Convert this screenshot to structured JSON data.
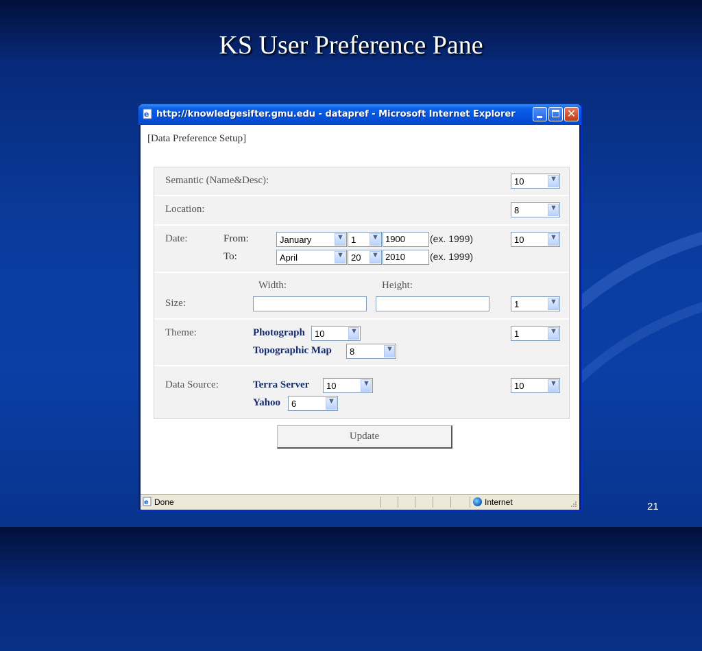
{
  "slide": {
    "title": "KS User Preference Pane",
    "page_number": "21"
  },
  "window": {
    "title": "http://knowledgesifter.gmu.edu - datapref - Microsoft Internet Explorer",
    "icons": {
      "page": "ie-page-icon",
      "minimize": "minimize-icon",
      "maximize": "maximize-icon",
      "close": "close-icon"
    },
    "close_glyph": "✕"
  },
  "form": {
    "heading": "[Data Preference Setup]",
    "semantic": {
      "label": "Semantic (Name&Desc):",
      "weight": "10"
    },
    "location": {
      "label": "Location:",
      "weight": "8"
    },
    "date": {
      "label": "Date:",
      "from_label": "From:",
      "from_month": "January",
      "from_day": "1",
      "from_year": "1900",
      "to_label": "To:",
      "to_month": "April",
      "to_day": "20",
      "to_year": "2010",
      "hint": "(ex. 1999)",
      "weight": "10"
    },
    "size": {
      "label": "Size:",
      "width_label": "Width:",
      "width_value": "",
      "height_label": "Height:",
      "height_value": "",
      "weight": "1"
    },
    "theme": {
      "label": "Theme:",
      "photograph_label": "Photograph",
      "photograph_value": "10",
      "topographic_label": "Topographic Map",
      "topographic_value": "8",
      "weight": "1"
    },
    "data_source": {
      "label": "Data Source:",
      "terra_label": "Terra Server",
      "terra_value": "10",
      "yahoo_label": "Yahoo",
      "yahoo_value": "6",
      "weight": "10"
    },
    "update_label": "Update",
    "dropdown_arrow": "▼"
  },
  "status_bar": {
    "status_text": "Done",
    "zone_text": "Internet"
  }
}
